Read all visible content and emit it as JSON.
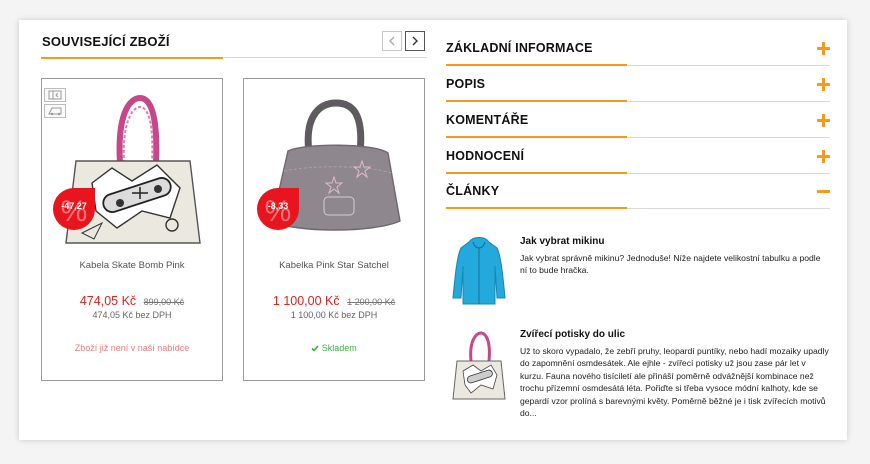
{
  "related": {
    "title": "SOUVISEJÍCÍ ZBOŽÍ",
    "products": [
      {
        "name": "Kabela Skate Bomb Pink",
        "discount": "-47,27",
        "price": "474,05 Kč",
        "old_price": "899,00 Kč",
        "price_novat": "474,05 Kč bez DPH",
        "availability": "Zboží již není v naší nabídce"
      },
      {
        "name": "Kabelka Pink Star Satchel",
        "discount": "-8,33",
        "price": "1 100,00 Kč",
        "old_price": "1 200,00 Kč",
        "price_novat": "1 100,00 Kč bez DPH",
        "availability": "Skladem"
      }
    ]
  },
  "accordion": [
    {
      "label": "ZÁKLADNÍ INFORMACE",
      "state": "collapsed"
    },
    {
      "label": "POPIS",
      "state": "collapsed"
    },
    {
      "label": "KOMENTÁŘE",
      "state": "collapsed"
    },
    {
      "label": "HODNOCENÍ",
      "state": "collapsed"
    },
    {
      "label": "ČLÁNKY",
      "state": "expanded"
    }
  ],
  "articles": [
    {
      "title": "Jak vybrat mikinu",
      "text": "Jak vybrat správně mikinu? Jednoduše! Níže najdete velikostní tabulku a podle ní to bude hračka."
    },
    {
      "title": "Zvířecí potisky do ulic",
      "text": "Už to skoro vypadalo, že zebří pruhy, leopardí puntíky, nebo hadí mozaiky upadly do zapomnění osmdesátek. Ale ejhle - zvířecí potisky už jsou zase pár let v kurzu. Fauna nového tisíciletí ale přináší poměrně odvážnější kombinace než trochu přízemní osmdesátá léta. Pořiďte si třeba vysoce módní kalhoty, kde se gepardí vzor prolíná s barevnými květy. Poměrně běžné je i tisk zvířecích motivů do..."
    }
  ],
  "icons": {
    "prev": "chevron-left-icon",
    "next": "chevron-right-icon",
    "expand": "plus-icon",
    "collapse": "minus-icon",
    "discount": "percent-badge-icon",
    "in_stock": "check-icon"
  },
  "colors": {
    "accent": "#f39a21",
    "price": "#e0201d",
    "discount_badge": "#e8141e",
    "in_stock": "#3cb043",
    "out_of_stock": "#f07a7a"
  }
}
